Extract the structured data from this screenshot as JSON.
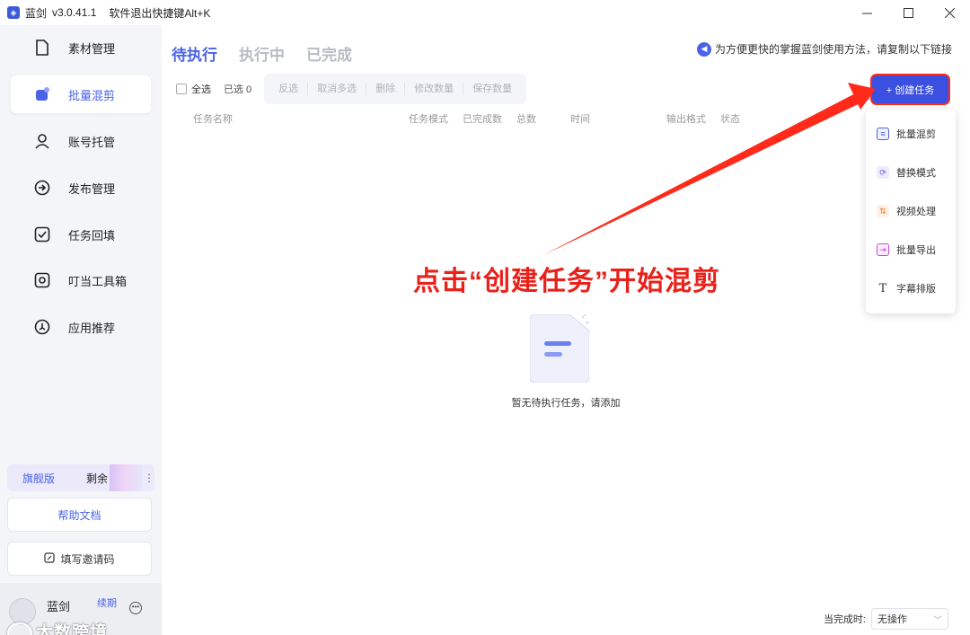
{
  "titlebar": {
    "app_name": "蓝剑",
    "version": "v3.0.41.1",
    "exit_hint": "软件退出快捷键Alt+K"
  },
  "sidebar": {
    "items": [
      {
        "label": "素材管理",
        "icon": "file-icon"
      },
      {
        "label": "批量混剪",
        "icon": "batch-mix-icon"
      },
      {
        "label": "账号托管",
        "icon": "user-icon"
      },
      {
        "label": "发布管理",
        "icon": "publish-icon"
      },
      {
        "label": "任务回填",
        "icon": "checkbox-icon"
      },
      {
        "label": "叮当工具箱",
        "icon": "toolbox-icon"
      },
      {
        "label": "应用推荐",
        "icon": "recommend-icon"
      }
    ],
    "active_index": 1,
    "plan": {
      "name": "旗舰版",
      "remaining": "剩余"
    },
    "help_doc": "帮助文档",
    "invite_code": "填写邀请码",
    "user": {
      "name": "蓝剑",
      "renew": "续期"
    },
    "watermark": "大数跨境"
  },
  "main": {
    "tabs": [
      "待执行",
      "执行中",
      "已完成"
    ],
    "active_tab": 0,
    "notice": "为方便更快的掌握蓝剑使用方法，请复制以下链接",
    "select_all": "全选",
    "selected_count": "已选 0",
    "tools": [
      "反选",
      "取消多选",
      "删除",
      "修改数量",
      "保存数量"
    ],
    "create_task": "+ 创建任务",
    "columns": [
      "任务名称",
      "任务模式",
      "已完成数",
      "总数",
      "时间",
      "输出格式",
      "状态"
    ],
    "dropdown": [
      {
        "label": "批量混剪",
        "icon": "batch-mix-icon"
      },
      {
        "label": "替换模式",
        "icon": "replace-icon"
      },
      {
        "label": "视频处理",
        "icon": "video-process-icon"
      },
      {
        "label": "批量导出",
        "icon": "export-icon"
      },
      {
        "label": "字幕排版",
        "icon": "subtitle-icon"
      }
    ],
    "empty_text": "暂无待执行任务，请添加",
    "annotation": "点击“创建任务”开始混剪",
    "footer": {
      "label": "当完成时:",
      "value": "无操作"
    }
  },
  "colors": {
    "accent": "#4a63e8",
    "create_button": "#3b4fe0",
    "annotation_red": "#e8211a",
    "sidebar_bg": "#f4f5f8"
  }
}
